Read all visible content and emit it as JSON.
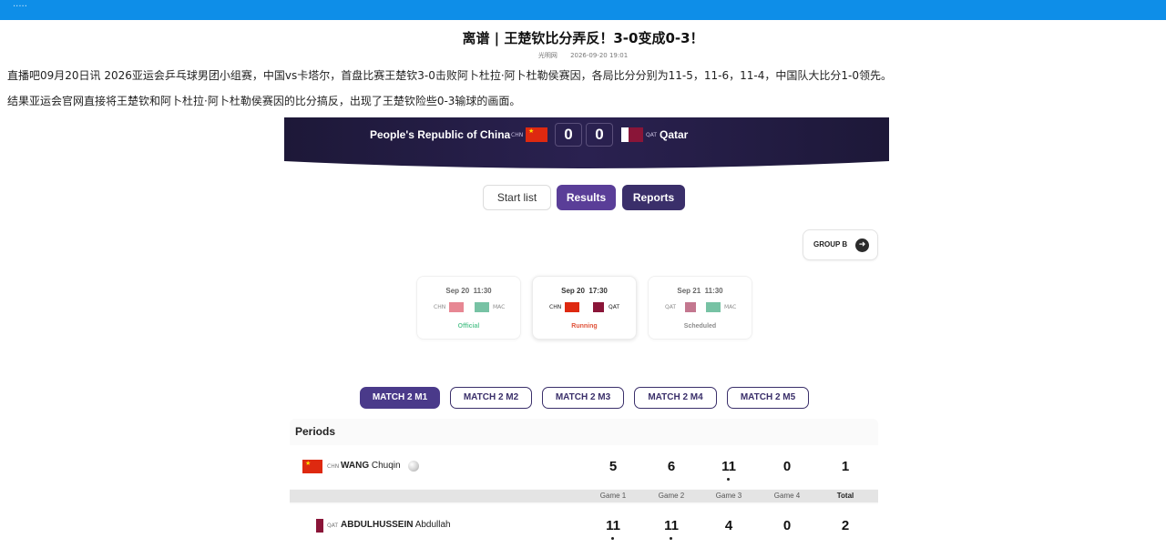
{
  "topbar": {
    "logo_text": "·····"
  },
  "article": {
    "title": "离谱 | 王楚钦比分弄反！3-0变成0-3！",
    "source": "光明网",
    "timestamp": "2026-09-20 19:01",
    "paragraph1": "直播吧09月20日讯 2026亚运会乒乓球男团小组赛，中国vs卡塔尔，首盘比赛王楚钦3-0击败阿卜杜拉·阿卜杜勒侯赛因，各局比分分别为11-5，11-6，11-4，中国队大比分1-0领先。",
    "paragraph2": "结果亚运会官网直接将王楚钦和阿卜杜拉·阿卜杜勒侯赛因的比分搞反，出现了王楚钦险些0-3输球的画面。"
  },
  "scoreboard": {
    "team_a": "People's Republic of China",
    "team_a_code": "CHN",
    "score_a": "0",
    "score_b": "0",
    "team_b_code": "QAT",
    "team_b": "Qatar"
  },
  "tabs": {
    "start_list": "Start list",
    "results": "Results",
    "reports": "Reports"
  },
  "group_button": "GROUP B",
  "match_cards": [
    {
      "date": "Sep 20",
      "time": "11:30",
      "home": "CHN",
      "away": "MAC",
      "status": "Official",
      "status_color": "#2bb673"
    },
    {
      "date": "Sep 20",
      "time": "17:30",
      "home": "CHN",
      "away": "QAT",
      "status": "Running",
      "status_color": "#e0533a"
    },
    {
      "date": "Sep 21",
      "time": "11:30",
      "home": "QAT",
      "away": "MAC",
      "status": "Scheduled",
      "status_color": "#666666"
    }
  ],
  "match_tabs": [
    "MATCH 2 M1",
    "MATCH 2 M2",
    "MATCH 2 M3",
    "MATCH 2 M4",
    "MATCH 2 M5"
  ],
  "periods": {
    "title": "Periods",
    "player1": {
      "code": "CHN",
      "surname": "WANG",
      "given": "Chuqin",
      "scores": [
        "5",
        "6",
        "11",
        "0",
        "1"
      ]
    },
    "game_labels": [
      "Game 1",
      "Game 2",
      "Game 3",
      "Game 4",
      "Total"
    ],
    "player2": {
      "code": "QAT",
      "surname": "ABDULHUSSEIN",
      "given": "Abdullah",
      "scores": [
        "11",
        "11",
        "4",
        "0",
        "2"
      ]
    }
  },
  "colors": {
    "topbar": "#0e8ee8",
    "primary": "#5a3e98",
    "dark": "#3a2f6a",
    "banner": "#1a1530"
  }
}
